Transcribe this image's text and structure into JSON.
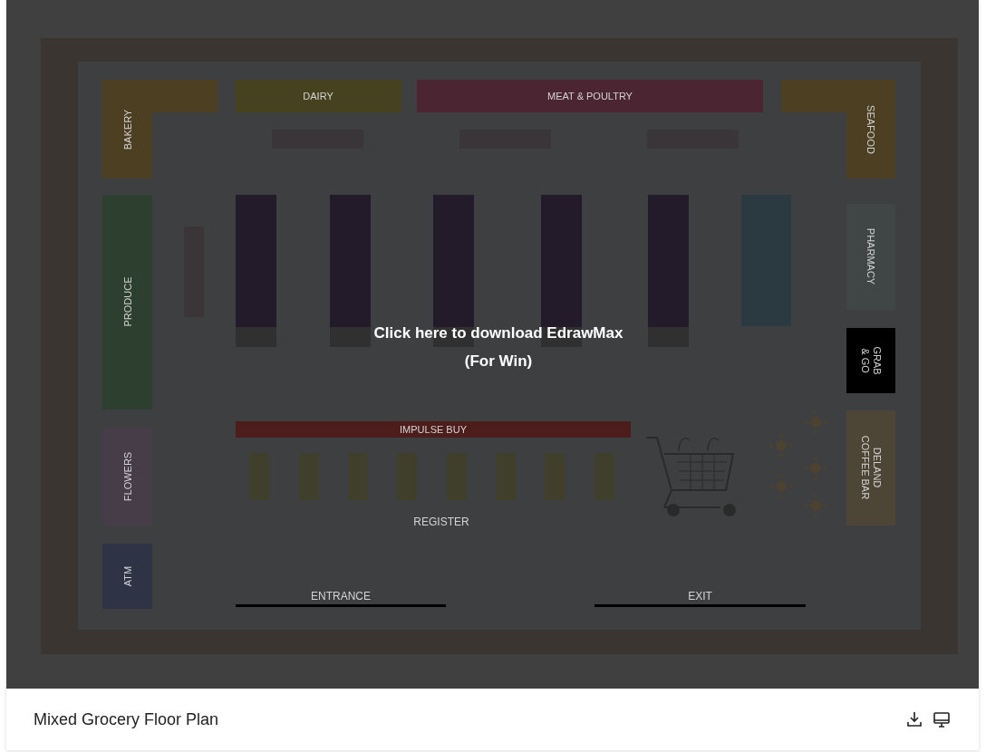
{
  "preview": {
    "overlay_lines": [
      "Click here to download EdrawMax",
      "(For Win)"
    ],
    "floor_plan": {
      "sections": [
        {
          "lines": [
            "BAKERY"
          ],
          "color": "#4d3f22"
        },
        {
          "lines": [
            "DAIRY"
          ],
          "color": "#46411f"
        },
        {
          "lines": [
            "MEAT & POULTRY"
          ],
          "color": "#4b2531"
        },
        {
          "lines": [
            "SEAFOOD"
          ],
          "color": "#4d3f22"
        },
        {
          "lines": [
            "PRODUCE"
          ],
          "color": "#2d3f2e"
        },
        {
          "lines": [
            "PHARMACY"
          ],
          "color": "#3f4645"
        },
        {
          "lines": [
            "GRAB",
            "& GO"
          ],
          "color": "#000000"
        },
        {
          "lines": [
            "FLOWERS"
          ],
          "color": "#463d49"
        },
        {
          "lines": [
            "ATM"
          ],
          "color": "#2e3445"
        },
        {
          "lines": [
            "DELAND",
            "COFFEE BAR"
          ],
          "color": "#4d4536"
        },
        {
          "lines": [
            "IMPULSE BUY"
          ],
          "color": "#4c1d1a"
        }
      ],
      "register_label": "REGISTER",
      "doors": [
        {
          "label": "ENTRANCE"
        },
        {
          "label": "EXIT"
        }
      ]
    }
  },
  "card": {
    "title": "Mixed Grocery Floor Plan"
  }
}
